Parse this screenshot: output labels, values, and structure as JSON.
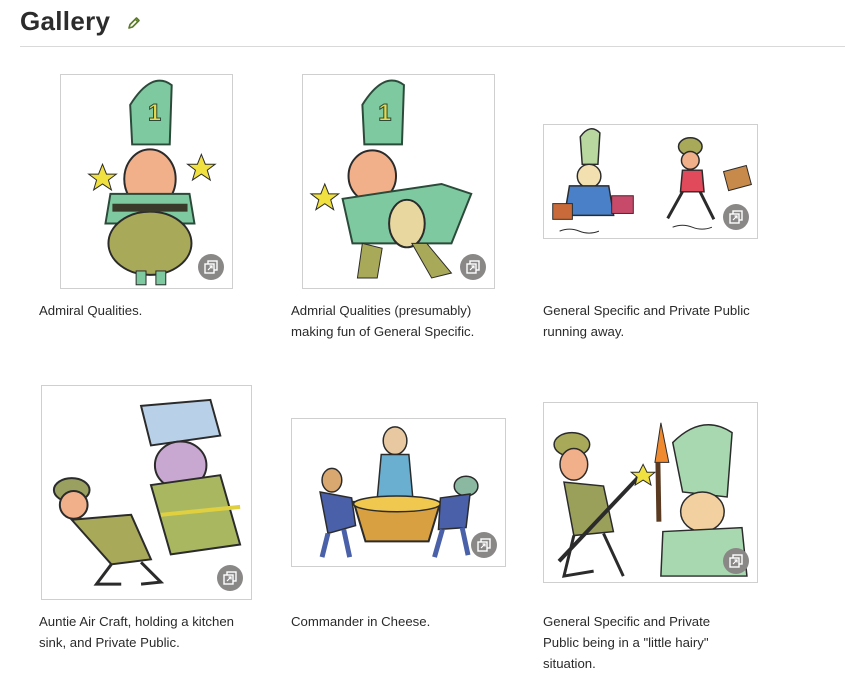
{
  "header": {
    "title": "Gallery",
    "edit_icon": "pencil-icon"
  },
  "gallery": {
    "expand_icon": "expand-icon",
    "items": [
      {
        "caption": "Admiral Qualities."
      },
      {
        "caption": "Admrial Qualities (presumably) making fun of General Specific."
      },
      {
        "caption": "General Specific and Private Public running away."
      },
      {
        "caption": "Auntie Air Craft, holding a kitchen sink, and Private Public."
      },
      {
        "caption": "Commander in Cheese."
      },
      {
        "caption": "General Specific and Private Public being in a \"little hairy\" situation."
      }
    ]
  },
  "colors": {
    "accent_pencil": "#5a7a2a",
    "expand_button": "#8a8787",
    "thumb_border": "#cfcfcf"
  }
}
